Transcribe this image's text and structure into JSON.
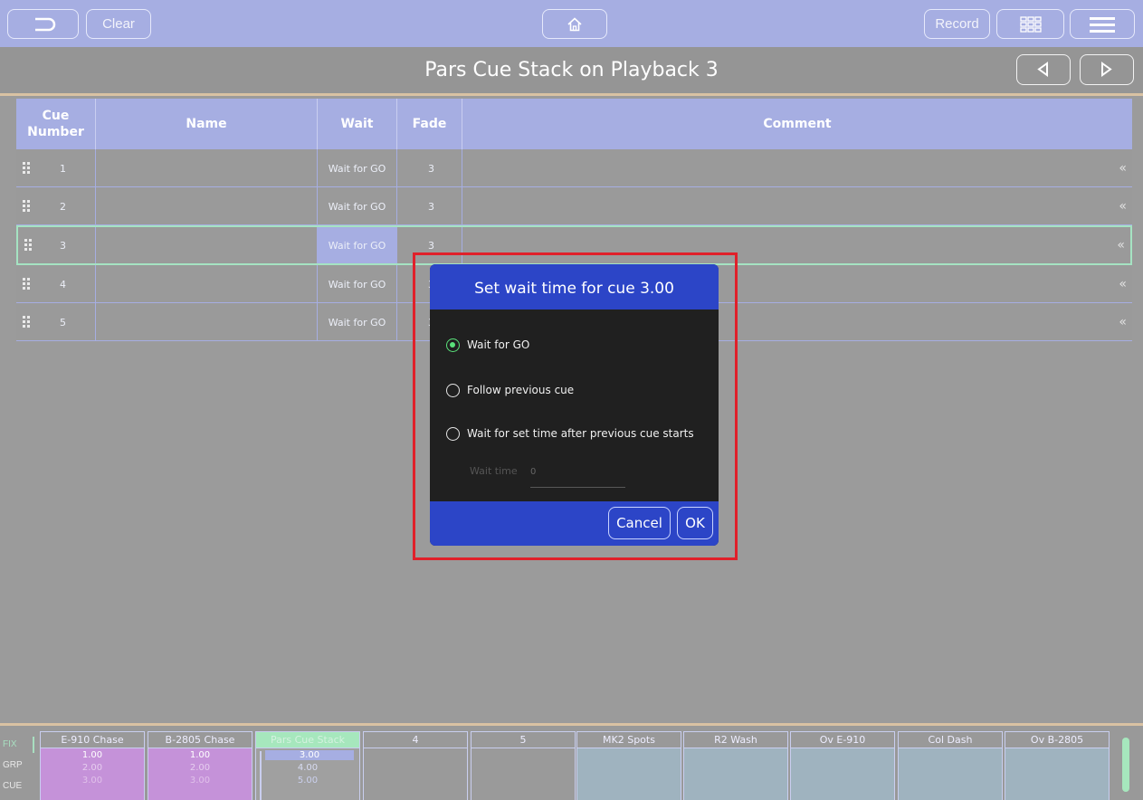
{
  "toolbar": {
    "clear_label": "Clear",
    "record_label": "Record"
  },
  "page_title": "Pars Cue Stack on Playback 3",
  "table": {
    "headers": {
      "cue_number": "Cue Number",
      "name": "Name",
      "wait": "Wait",
      "fade": "Fade",
      "comment": "Comment"
    },
    "rows": [
      {
        "number": "1",
        "name": "",
        "wait": "Wait for GO",
        "fade": "3",
        "comment": ""
      },
      {
        "number": "2",
        "name": "",
        "wait": "Wait for GO",
        "fade": "3",
        "comment": ""
      },
      {
        "number": "3",
        "name": "",
        "wait": "Wait for GO",
        "fade": "3",
        "comment": ""
      },
      {
        "number": "4",
        "name": "",
        "wait": "Wait for GO",
        "fade": "3",
        "comment": ""
      },
      {
        "number": "5",
        "name": "",
        "wait": "Wait for GO",
        "fade": "3",
        "comment": ""
      }
    ],
    "selected_row": 3,
    "row_more_glyph": "«"
  },
  "dialog": {
    "title": "Set wait time for cue 3.00",
    "options": [
      {
        "label": "Wait for GO",
        "selected": true
      },
      {
        "label": "Follow previous cue",
        "selected": false
      },
      {
        "label": "Wait for set time after previous cue starts",
        "selected": false
      }
    ],
    "wait_time_label": "Wait time",
    "wait_time_value": "0",
    "cancel_label": "Cancel",
    "ok_label": "OK"
  },
  "bottom_bar": {
    "side_labels": [
      "FIX",
      "GRP",
      "CUE"
    ],
    "playbacks": [
      {
        "label": "E-910 Chase",
        "lines": [
          "1.00",
          "2.00",
          "3.00"
        ],
        "state": "active"
      },
      {
        "label": "B-2805 Chase",
        "lines": [
          "1.00",
          "2.00",
          "3.00"
        ],
        "state": "active"
      },
      {
        "label": "Pars Cue Stack",
        "lines": [
          "3.00",
          "4.00",
          "5.00"
        ],
        "state": "current"
      },
      {
        "label": "4",
        "lines": [],
        "state": "empty"
      },
      {
        "label": "5",
        "lines": [],
        "state": "empty"
      },
      {
        "label": "MK2 Spots",
        "lines": [],
        "state": "assigned"
      },
      {
        "label": "R2 Wash",
        "lines": [],
        "state": "assigned"
      },
      {
        "label": "Ov E-910",
        "lines": [],
        "state": "assigned"
      },
      {
        "label": "Col Dash",
        "lines": [],
        "state": "assigned"
      },
      {
        "label": "Ov B-2805",
        "lines": [],
        "state": "assigned"
      }
    ]
  },
  "colors": {
    "accent_blue": "#2c45c7",
    "toolbar_lilac": "#a6aee2",
    "selection_green": "#59e27a",
    "highlight_red": "#e0202a",
    "playback_active": "#c592d9",
    "playback_assigned": "#9fb3bf"
  },
  "icons": [
    "back-icon",
    "home-icon",
    "grid-icon",
    "menu-icon",
    "prev-arrow-icon",
    "next-arrow-icon",
    "drag-handle-icon",
    "row-more-icon"
  ]
}
